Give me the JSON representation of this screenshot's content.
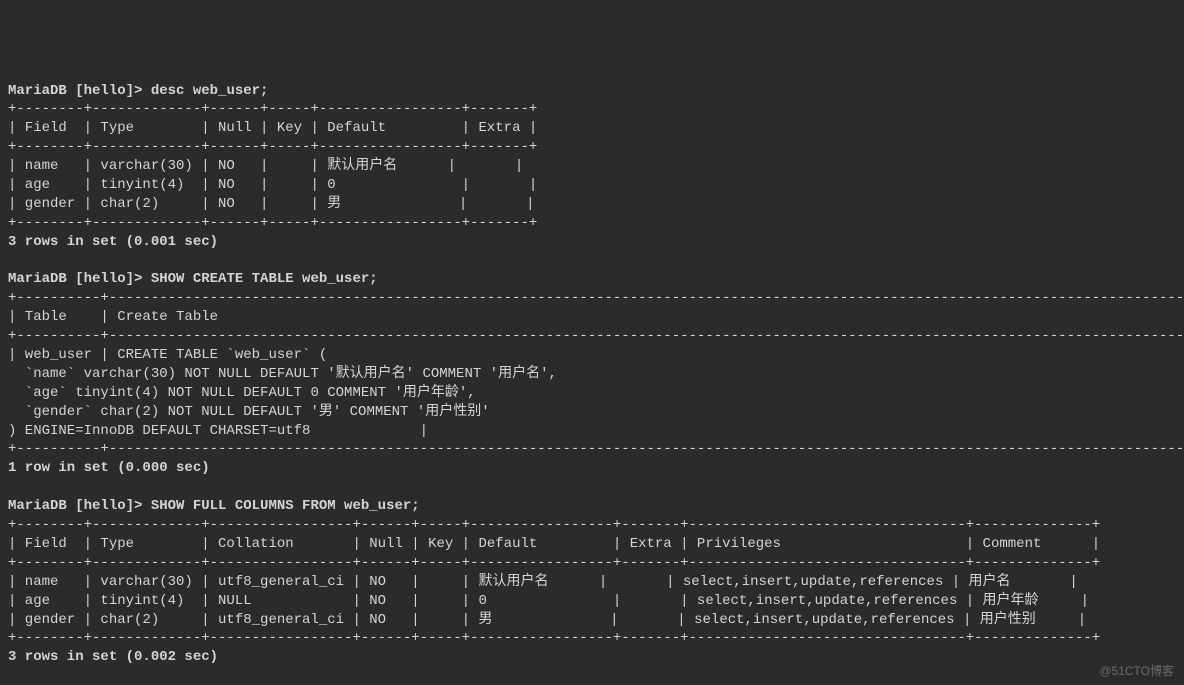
{
  "prompt": "MariaDB [hello]> ",
  "cmd1": "desc web_user;",
  "cmd2": "SHOW CREATE TABLE web_user;",
  "cmd3": "SHOW FULL COLUMNS FROM web_user;",
  "desc": {
    "border_top": "+--------+-------------+------+-----+-----------------+-------+",
    "header": "| Field  | Type        | Null | Key | Default         | Extra |",
    "rows": [
      "| name   | varchar(30) | NO   |     | 默认用户名      |       |",
      "| age    | tinyint(4)  | NO   |     | 0               |       |",
      "| gender | char(2)     | NO   |     | 男              |       |"
    ],
    "footer": "3 rows in set (0.001 sec)"
  },
  "create": {
    "border_top": "+----------+---------------------------------------------------------------------------------------------------------------------------------------+",
    "header": "| Table    | Create Table                                                                                                                          |",
    "border_mid": "+----------+---------------------------------------------------------------------------------------------------------------------------------------+",
    "row_lines": [
      "| web_user | CREATE TABLE `web_user` (",
      "  `name` varchar(30) NOT NULL DEFAULT '默认用户名' COMMENT '用户名',",
      "  `age` tinyint(4) NOT NULL DEFAULT 0 COMMENT '用户年龄',",
      "  `gender` char(2) NOT NULL DEFAULT '男' COMMENT '用户性别'",
      ") ENGINE=InnoDB DEFAULT CHARSET=utf8             |"
    ],
    "footer": "1 row in set (0.000 sec)"
  },
  "full": {
    "border_top": "+--------+-------------+-----------------+------+-----+-----------------+-------+---------------------------------+--------------+",
    "header": "| Field  | Type        | Collation       | Null | Key | Default         | Extra | Privileges                      | Comment      |",
    "rows": [
      "| name   | varchar(30) | utf8_general_ci | NO   |     | 默认用户名      |       | select,insert,update,references | 用户名       |",
      "| age    | tinyint(4)  | NULL            | NO   |     | 0               |       | select,insert,update,references | 用户年龄     |",
      "| gender | char(2)     | utf8_general_ci | NO   |     | 男              |       | select,insert,update,references | 用户性别     |"
    ],
    "footer": "3 rows in set (0.002 sec)"
  },
  "watermark": "@51CTO博客"
}
